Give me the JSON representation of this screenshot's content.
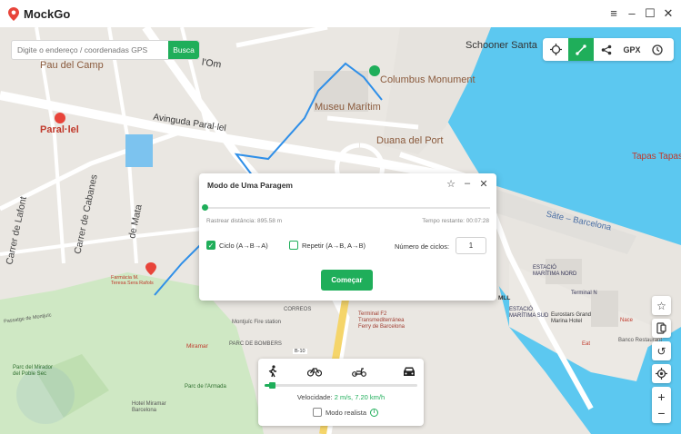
{
  "app": {
    "name": "MockGo"
  },
  "window": {
    "minimize": "–",
    "list": "≡",
    "maximize": "☐",
    "close": "✕"
  },
  "search": {
    "placeholder": "Digite o endereço / coordenadas GPS",
    "button": "Busca"
  },
  "toolbar": {
    "gpx_label": "GPX",
    "active_tool": "two-spot-mode"
  },
  "map": {
    "labels": {
      "paral_lel_metro": "Paral·lel",
      "pau_del_camp": "Pau del Camp",
      "av_paral_lel": "Avinguda Paral·lel",
      "carrer_lafont": "Carrer de Lafont",
      "carrer_cabanes": "Carrer de Cabanes",
      "de_mata": "de Mata",
      "schooner": "Schooner Santa",
      "om": "l'Om",
      "columbus": "Columbus Monument",
      "museu": "Museu Marítim",
      "duana": "Duana del Port",
      "tapas": "Tapas Tapas",
      "sate": "Sàte – Barcelona",
      "estacio_nord": "ESTACIÓ\nMARÍTIMA NORD",
      "estacio_sud": "ESTACIÓ\nMARÍTIMA SUD",
      "terminal_n": "Terminal N",
      "eurostars": "Eurostars Grand\nMarina Hotel",
      "terminal_f2": "Terminal F2\nTransmediterránea\nFerry de Barcelona",
      "correos": "CORREOS",
      "parc_bombers": "PARC DE BOMBERS",
      "montjuic_fire": "Montjuïc Fire station",
      "mirador": "Parc del Mirador\ndel Poble Sec",
      "miramar": "Miramar",
      "hotel_miramar": "Hotel Miramar\nBarcelona",
      "farmacia": "Farmàcia M.\nTeresa Sera Rafols",
      "passatge": "Passatge de Montjuïc",
      "parc_armada": "Parc de l'Armada",
      "b10": "B-10",
      "nace": "Nace",
      "eat": "Eat",
      "banco": "Banco Restaurant",
      "num_mll": "MLL"
    }
  },
  "modal": {
    "title": "Modo de Uma Paragem",
    "distance": "Rastrear distância: 895.58 m",
    "remaining": "Tempo restante: 00:07:28",
    "option_cycle": "Ciclo (A→B→A)",
    "option_repeat": "Repetir (A→B, A→B)",
    "cycles_label": "Número de ciclos:",
    "cycles_value": "1",
    "start": "Começar",
    "progress": 0.0
  },
  "speed": {
    "label": "Velocidade:",
    "value": "2 m/s, 7.20 km/h",
    "realistic": "Modo realista",
    "level": 0.05,
    "modes": [
      "walk",
      "bike",
      "scooter",
      "car"
    ]
  },
  "colors": {
    "accent": "#1fae5a",
    "water": "#5cc8f0",
    "park": "#cfe8c4",
    "road": "#ffffff",
    "route": "#2f8fe8"
  }
}
